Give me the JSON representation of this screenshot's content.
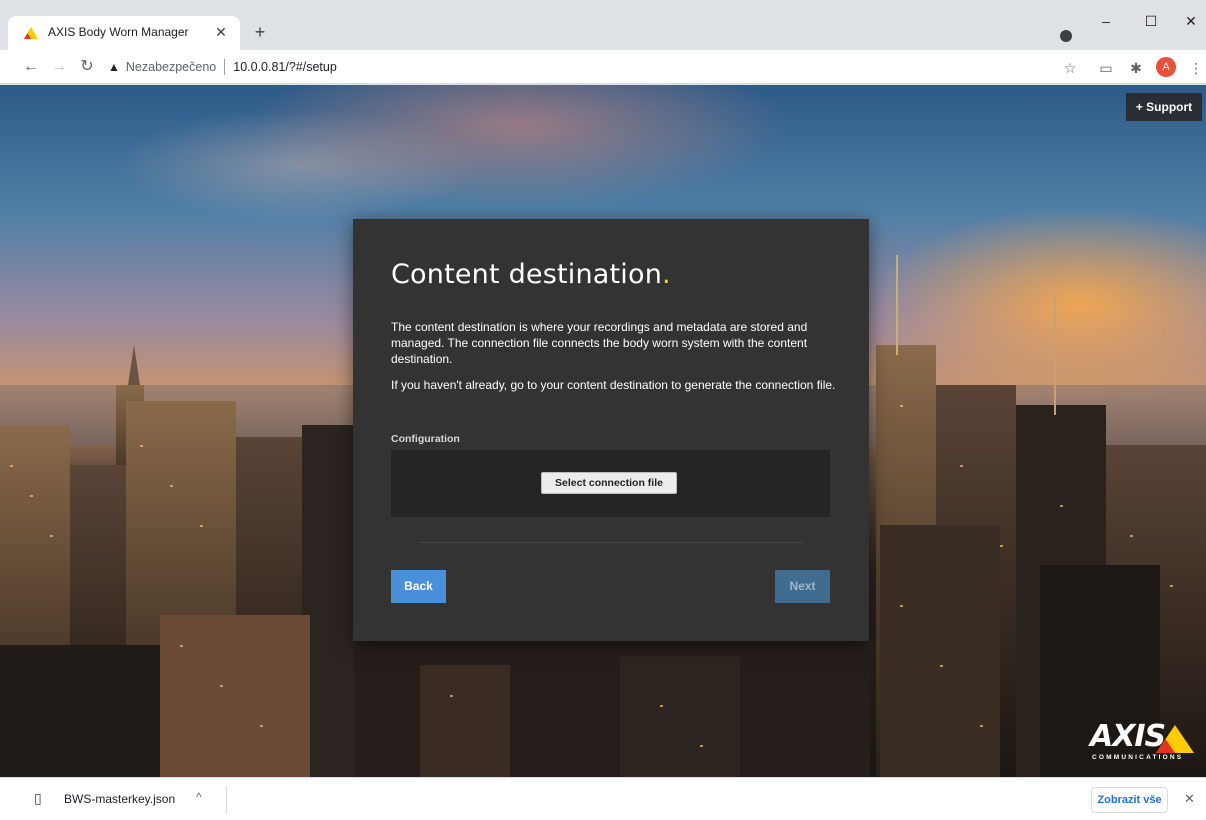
{
  "browser": {
    "tab_title": "AXIS Body Worn Manager",
    "tab_close": "✕",
    "new_tab": "+",
    "security_label": "Nezabezpečeno",
    "url": "10.0.0.81/?#/setup",
    "profile_initial": "A",
    "window_controls": {
      "minimize": "–",
      "maximize": "☐",
      "close": "✕"
    },
    "nav": {
      "back": "←",
      "forward": "→",
      "reload": "↻"
    }
  },
  "page": {
    "support_label": "+ Support",
    "card": {
      "title": "Content destination",
      "title_dot": ".",
      "description": "The content destination is where your recordings and metadata are stored and managed. The connection file connects the body worn system with the content destination.",
      "description2": "If you haven't already, go to your content destination to generate the connection file.",
      "config_label": "Configuration",
      "select_file_label": "Select connection file",
      "back_label": "Back",
      "next_label": "Next"
    },
    "logo": {
      "wordmark": "AXIS",
      "subtitle": "COMMUNICATIONS"
    }
  },
  "download_bar": {
    "filename": "BWS-masterkey.json",
    "show_all_label": "Zobrazit vše",
    "close": "✕"
  },
  "colors": {
    "accent_yellow": "#ffcc33",
    "primary_button": "#4a90d9",
    "disabled_button": "#3f6d92",
    "card_bg": "#333333"
  }
}
